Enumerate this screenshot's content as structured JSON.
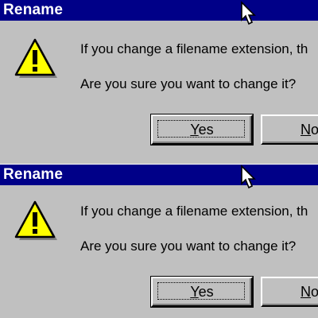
{
  "dialogs": [
    {
      "title": "Rename",
      "message_line1": "If you change a filename extension, th",
      "message_line2": "Are you sure you want to change it?",
      "yes_accel": "Y",
      "yes_rest": "es",
      "no_accel": "N",
      "no_rest": "o",
      "icon": "warning-icon"
    },
    {
      "title": "Rename",
      "message_line1": "If you change a filename extension, th",
      "message_line2": "Are you sure you want to change it?",
      "yes_accel": "Y",
      "yes_rest": "es",
      "no_accel": "N",
      "no_rest": "o",
      "icon": "warning-icon"
    }
  ],
  "colors": {
    "titlebar": "#000088",
    "dialog_bg": "#c0c0c0",
    "warning_fill": "#ffff00"
  }
}
